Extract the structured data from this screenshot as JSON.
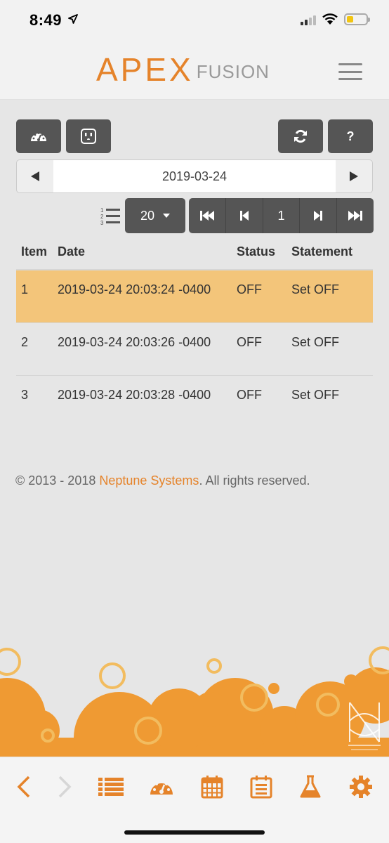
{
  "status_bar": {
    "time": "8:49"
  },
  "header": {
    "logo_primary": "APEX",
    "logo_secondary": "FUSION"
  },
  "toolbar": {
    "help_label": "?"
  },
  "date_nav": {
    "date": "2019-03-24"
  },
  "pagination": {
    "page_size": "20",
    "current_page": "1"
  },
  "table": {
    "headers": {
      "item": "Item",
      "date": "Date",
      "status": "Status",
      "statement": "Statement"
    },
    "rows": [
      {
        "item": "1",
        "date": "2019-03-24 20:03:24 -0400",
        "status": "OFF",
        "statement": "Set OFF"
      },
      {
        "item": "2",
        "date": "2019-03-24 20:03:26 -0400",
        "status": "OFF",
        "statement": "Set OFF"
      },
      {
        "item": "3",
        "date": "2019-03-24 20:03:28 -0400",
        "status": "OFF",
        "statement": "Set OFF"
      }
    ]
  },
  "footer": {
    "copyright_prefix": "© 2013 - 2018 ",
    "company_link": "Neptune Systems",
    "copyright_suffix": ". All rights reserved."
  },
  "colors": {
    "accent": "#e5832a",
    "button_dark": "#555555",
    "highlight_row": "#f3c57a"
  },
  "icons": {
    "toolbar": [
      "dashboard-icon",
      "outlet-icon",
      "refresh-icon",
      "help-icon"
    ],
    "bottom_nav": [
      "back-icon",
      "forward-icon",
      "list-icon",
      "dashboard-icon",
      "calendar-icon",
      "log-icon",
      "flask-icon",
      "gear-icon"
    ]
  }
}
